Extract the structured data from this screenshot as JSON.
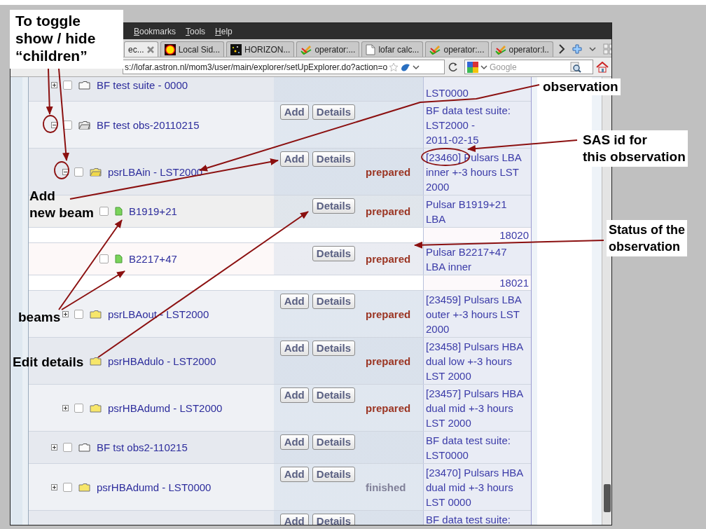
{
  "browser": {
    "menu": [
      "Bookmarks",
      "Tools",
      "Help"
    ],
    "tabs": [
      {
        "label": "ec...",
        "selected": true,
        "kind": "none"
      },
      {
        "label": "Local Sid...",
        "selected": false,
        "kind": "sun"
      },
      {
        "label": "HORIZON...",
        "selected": false,
        "kind": "stars"
      },
      {
        "label": "operator:...",
        "selected": false,
        "kind": "pencil"
      },
      {
        "label": "lofar calc...",
        "selected": false,
        "kind": "page"
      },
      {
        "label": "operator:...",
        "selected": false,
        "kind": "pencil"
      },
      {
        "label": "operator:l..",
        "selected": false,
        "kind": "pencil"
      }
    ],
    "url": "s://lofar.astron.nl/mom3/user/main/explorer/setUpExplorer.do?action=o",
    "search": {
      "placeholder": "Google"
    }
  },
  "explorer": {
    "rows": [
      {
        "name": "BF test suite - 0000",
        "kind": "folder",
        "expanded": false,
        "checked": false,
        "desc": "LST0000"
      },
      {
        "name": "BF test obs-20110215",
        "kind": "folder",
        "expanded": true,
        "checked": false,
        "buttons": [
          "Add",
          "Details"
        ],
        "desc": "BF data test suite: LST2000 - 2011-02-15",
        "children": [
          {
            "name": "psrLBAin - LST2000",
            "kind": "observation",
            "expanded": true,
            "checked": false,
            "buttons": [
              "Add",
              "Details"
            ],
            "status": "prepared",
            "done": false,
            "desc": "[23460] Pulsars LBA inner +-3 hours LST 2000",
            "children": [
              {
                "name": "B1919+21",
                "kind": "beam",
                "checked": false,
                "buttons": [
                  "Details"
                ],
                "status": "prepared",
                "done": false,
                "desc": "Pulsar B1919+21 LBA",
                "number": "18020"
              },
              {
                "name": "B2217+47",
                "kind": "beam",
                "checked": false,
                "buttons": [
                  "Details"
                ],
                "status": "prepared",
                "done": false,
                "desc": "Pulsar B2217+47 LBA inner",
                "number": "18021"
              }
            ]
          },
          {
            "name": "psrLBAout - LST2000",
            "kind": "observation",
            "expanded": false,
            "checked": false,
            "buttons": [
              "Add",
              "Details"
            ],
            "status": "prepared",
            "done": false,
            "desc": "[23459] Pulsars LBA outer +-3 hours LST 2000"
          },
          {
            "name": "psrHBAdulo - LST2000",
            "kind": "observation",
            "buttons": [
              "Add",
              "Details"
            ],
            "status": "prepared",
            "done": false,
            "desc": "[23458] Pulsars HBA dual low +-3 hours LST 2000"
          },
          {
            "name": "psrHBAdumd - LST2000",
            "kind": "observation",
            "expanded": false,
            "checked": false,
            "buttons": [
              "Add",
              "Details"
            ],
            "status": "prepared",
            "done": false,
            "desc": "[23457] Pulsars HBA dual mid +-3 hours LST 2000"
          }
        ]
      },
      {
        "name": "BF tst obs2-110215",
        "kind": "folder",
        "expanded": false,
        "checked": false,
        "buttons": [
          "Add",
          "Details"
        ],
        "desc": "BF data test suite: LST0000"
      },
      {
        "name": "psrHBAdumd - LST0000",
        "kind": "observation",
        "expanded": false,
        "checked": false,
        "buttons": [
          "Add",
          "Details"
        ],
        "status": "finished",
        "done": true,
        "desc": "[23470] Pulsars HBA dual mid +-3 hours LST 0000"
      },
      {
        "buttons": [
          "Add",
          "Details"
        ],
        "desc": "BF data test suite:"
      }
    ]
  },
  "annotations": [
    {
      "text": "To toggle\nshow / hide\n“children”",
      "boxed": true
    },
    {
      "text": "observation",
      "boxed": true
    },
    {
      "text": "SAS id for\nthis observation",
      "boxed": true
    },
    {
      "text": "Add\nnew beam",
      "boxed": false
    },
    {
      "text": "Status of the\nobservation",
      "boxed": true
    },
    {
      "text": "beams",
      "boxed": false
    },
    {
      "text": "Edit details",
      "boxed": false
    }
  ]
}
